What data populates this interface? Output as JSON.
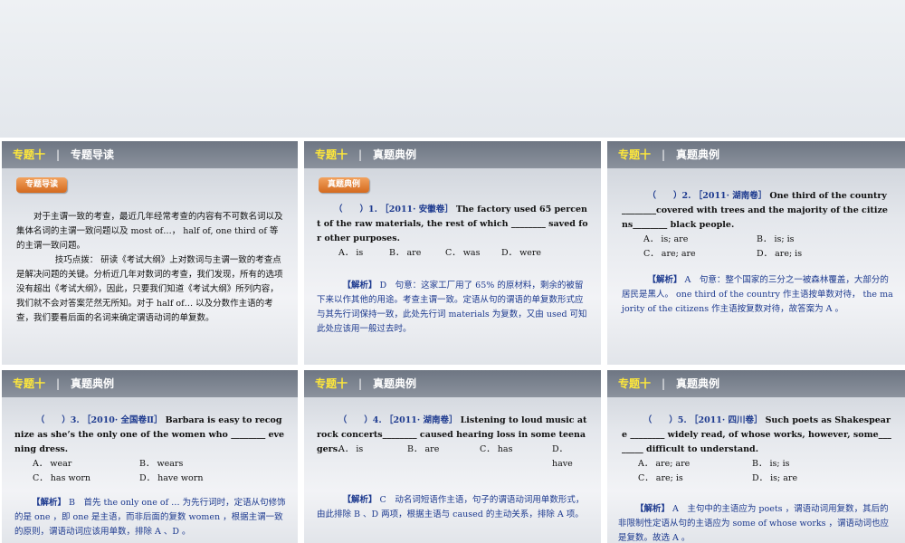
{
  "slides": [
    {
      "topic": "专题十",
      "separator": "|",
      "title": "专题导读",
      "badge": "专题导读",
      "para1": "对于主谓一致的考查，最近几年经常考查的内容有不可数名词以及集体名词的主谓一致问题以及 most of…， half of, one third of 等的主谓一致问题。",
      "para2": "技巧点拨： 研读《考试大纲》上对数词与主谓一致的考查点是解决问题的关键。分析近几年对数词的考查，我们发现，所有的选项没有超出《考试大纲》，因此，只要我们知道《考试大纲》所列内容，我们就不会对答案茫然无所知。对于 half of… 以及分数作主语的考查，我们要看后面的名词来确定谓语动词的单复数。"
    },
    {
      "topic": "专题十",
      "separator": "|",
      "title": "真题典例",
      "badge": "真题典例",
      "question_prefix": "（　　）1. ［2011· 安徽卷］",
      "question_body": "The factory used 65 percent of the raw materials, the rest of which ________ saved for other purposes.",
      "options": [
        "A． is",
        "B． are",
        "C． was",
        "D． were"
      ],
      "analysis_tag": "【解析】",
      "analysis": "D　句意：这家工厂用了 65% 的原材料，剩余的被留下来以作其他的用途。考查主谓一致。定语从句的谓语的单复数形式应与其先行词保持一致，此处先行词 materials 为复数，又由 used 可知此处应该用一般过去时。"
    },
    {
      "topic": "专题十",
      "separator": "|",
      "title": "真题典例",
      "question_prefix": "（　　）2. ［2011· 湖南卷］",
      "question_body": "One third of the country ________covered with trees and the majority of the citizens________ black people.",
      "options": [
        "A． is; are",
        "B． is; is",
        "C． are; are",
        "D． are; is"
      ],
      "analysis_tag": "【解析】",
      "analysis": "A　句意：整个国家的三分之一被森林覆盖，大部分的居民是黑人。 one third of the country 作主语按单数对待， the majority of the citizens 作主语按复数对待，故答案为 A 。"
    },
    {
      "topic": "专题十",
      "separator": "|",
      "title": "真题典例",
      "question_prefix": "（　　）3. ［2010· 全国卷Ⅱ］",
      "question_body": "Barbara is easy to recognize as she’s the only one of the women who ________ evening dress.",
      "options": [
        "A． wear",
        "B． wears",
        "C． has worn",
        "D． have worn"
      ],
      "analysis_tag": "【解析】",
      "analysis": "B　首先 the only one of … 为先行词时，定语从句修饰的是 one ，即 one 是主语，而非后面的复数 women ，根据主谓一致的原则，谓语动词应该用单数，排除 A 、D 。"
    },
    {
      "topic": "专题十",
      "separator": "|",
      "title": "真题典例",
      "question_prefix": "（　　）4. ［2011· 湖南卷］",
      "question_body": "Listening to loud music at rock concerts________ caused hearing loss in some teenagers.",
      "options": [
        "A． is",
        "B． are",
        "C． has",
        "D． have"
      ],
      "analysis_tag": "【解析】",
      "analysis": "C　动名词短语作主语，句子的谓语动词用单数形式，由此排除 B 、D 两项，根据主语与 caused 的主动关系，排除 A 项。"
    },
    {
      "topic": "专题十",
      "separator": "|",
      "title": "真题典例",
      "question_prefix": "（　　）5. ［2011· 四川卷］",
      "question_body": "Such poets as Shakespeare ________ widely read, of whose works, however, some________ difficult to understand.",
      "options": [
        "A． are; are",
        "B． is; is",
        "C． are; is",
        "D． is; are"
      ],
      "analysis_tag": "【解析】",
      "analysis": "A　主句中的主语应为 poets ，谓语动词用复数，其后的非限制性定语从句的主语应为 some of whose works ，谓语动词也应是复数。故选 A 。"
    }
  ]
}
